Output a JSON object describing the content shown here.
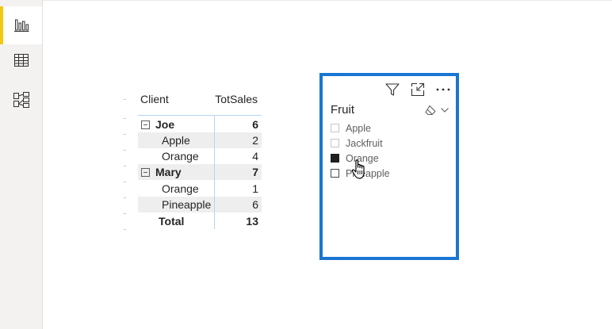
{
  "rail": {
    "items": [
      {
        "name": "report-view",
        "icon": "bar-chart-icon",
        "active": true
      },
      {
        "name": "data-view",
        "icon": "table-grid-icon",
        "active": false
      },
      {
        "name": "model-view",
        "icon": "model-diagram-icon",
        "active": false
      }
    ],
    "accent_color": "#f2c811"
  },
  "matrix": {
    "headers": {
      "client": "Client",
      "sales": "TotSales"
    },
    "rows": [
      {
        "label": "Joe",
        "value": "6",
        "level": 0,
        "bold": true,
        "shaded": false
      },
      {
        "label": "Apple",
        "value": "2",
        "level": 1,
        "bold": false,
        "shaded": true
      },
      {
        "label": "Orange",
        "value": "4",
        "level": 1,
        "bold": false,
        "shaded": false
      },
      {
        "label": "Mary",
        "value": "7",
        "level": 0,
        "bold": true,
        "shaded": true
      },
      {
        "label": "Orange",
        "value": "1",
        "level": 1,
        "bold": false,
        "shaded": false
      },
      {
        "label": "Pineapple",
        "value": "6",
        "level": 1,
        "bold": false,
        "shaded": true
      },
      {
        "label": "Total",
        "value": "13",
        "level": 0,
        "bold": true,
        "shaded": false
      }
    ]
  },
  "slicer": {
    "title": "Fruit",
    "border_color": "#1976d2",
    "toolbar_icons": [
      "filter-icon",
      "focus-mode-icon",
      "more-options-icon"
    ],
    "items": [
      {
        "label": "Apple",
        "checked": false
      },
      {
        "label": "Jackfruit",
        "checked": false
      },
      {
        "label": "Orange",
        "checked": true
      },
      {
        "label": "Pineapple",
        "checked": false
      }
    ]
  }
}
